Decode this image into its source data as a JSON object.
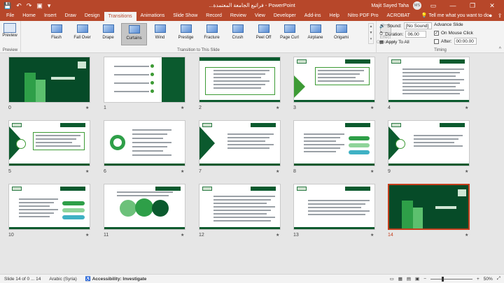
{
  "titlebar": {
    "doc_title": "...فراتيع الجامعة المعتمدة - PowerPoint",
    "user_name": "Majit Sayed Taha",
    "user_initials": "MS",
    "qat": {
      "save": "💾",
      "undo": "↶",
      "redo": "↷",
      "present": "▣",
      "customize": "▾"
    },
    "window": {
      "minimize": "—",
      "restore": "❐",
      "close": "✕"
    },
    "ribbon_display": "▭"
  },
  "tabs": [
    "File",
    "Home",
    "Insert",
    "Draw",
    "Design",
    "Transitions",
    "Animations",
    "Slide Show",
    "Record",
    "Review",
    "View",
    "Developer",
    "Add-ins",
    "Help",
    "Nitro PDF Pro",
    "ACROBAT"
  ],
  "active_tab": "Transitions",
  "tell_me": "💡  Tell me what you want to do",
  "tab_icons": {
    "record": "⏺",
    "share": "⇪"
  },
  "ribbon": {
    "preview_group": {
      "button_label": "Preview",
      "group_label": "Preview"
    },
    "transitions_group_label": "Transition to This Slide",
    "transitions": [
      "Flash",
      "Fall Over",
      "Drape",
      "Curtains",
      "Wind",
      "Prestige",
      "Fracture",
      "Crush",
      "Peel Off",
      "Page Curl",
      "Airplane",
      "Origami"
    ],
    "selected_transition": "Curtains",
    "effect_options": "Effect Options ▾",
    "scroll": {
      "up": "▲",
      "down": "▼",
      "more": "▾"
    },
    "timing": {
      "group_label": "Timing",
      "sound_label": "Sound:",
      "sound_value": "[No Sound]",
      "duration_label": "Duration:",
      "duration_value": "06.00",
      "apply_all": "Apply To All",
      "advance_label": "Advance Slide",
      "on_mouse_click": "On Mouse Click",
      "on_mouse_click_mark": "✓",
      "after_label": "After:",
      "after_value": "00:00.00",
      "collapse": "^"
    }
  },
  "slides": [
    {
      "n": "0",
      "t": "title",
      "star": "★"
    },
    {
      "n": "1",
      "t": "toc",
      "star": "★"
    },
    {
      "n": "2",
      "t": "quote",
      "star": "★"
    },
    {
      "n": "3",
      "t": "quote-box",
      "star": "★"
    },
    {
      "n": "4",
      "t": "text",
      "star": "★"
    },
    {
      "n": "5",
      "t": "tri-box",
      "star": "★"
    },
    {
      "n": "6",
      "t": "circle",
      "star": "★"
    },
    {
      "n": "7",
      "t": "tri-quote",
      "star": "★"
    },
    {
      "n": "8",
      "t": "pills",
      "star": "★"
    },
    {
      "n": "9",
      "t": "tri-text",
      "star": "★"
    },
    {
      "n": "10",
      "t": "pills2",
      "star": "★"
    },
    {
      "n": "11",
      "t": "bubbles",
      "star": "★"
    },
    {
      "n": "12",
      "t": "text",
      "star": "★"
    },
    {
      "n": "13",
      "t": "text2",
      "star": "★"
    },
    {
      "n": "14",
      "t": "dark",
      "star": "★"
    }
  ],
  "selected_slide": "14",
  "statusbar": {
    "slide_info": "Slide 14 of 0 ... 14",
    "language": "Arabic (Syria)",
    "accessibility": "Accessibility: Investigate",
    "zoom": "50%",
    "zoom_minus": "−",
    "zoom_plus": "+",
    "fit_slide": "⤢",
    "view_normal": "▭",
    "view_sorter": "▦",
    "view_reading": "▤",
    "view_show": "▣"
  }
}
